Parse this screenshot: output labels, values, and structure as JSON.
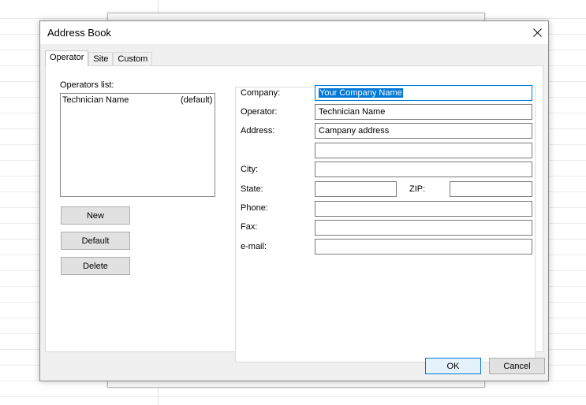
{
  "window": {
    "title": "Address Book"
  },
  "tabs": [
    {
      "label": "Operator",
      "active": true
    },
    {
      "label": "Site",
      "active": false
    },
    {
      "label": "Custom",
      "active": false
    }
  ],
  "operators": {
    "list_label": "Operators list:",
    "items": [
      {
        "name": "Technician Name",
        "tag": "(default)"
      }
    ],
    "buttons": {
      "new": "New",
      "default": "Default",
      "delete": "Delete"
    }
  },
  "form": {
    "company": {
      "label": "Company:",
      "value": "Your Company Name"
    },
    "operator": {
      "label": "Operator:",
      "value": "Technician Name"
    },
    "address": {
      "label": "Address:",
      "value": "Campany address",
      "line2": ""
    },
    "city": {
      "label": "City:",
      "value": ""
    },
    "state": {
      "label": "State:",
      "value": ""
    },
    "zip": {
      "label": "ZIP:",
      "value": ""
    },
    "phone": {
      "label": "Phone:",
      "value": ""
    },
    "fax": {
      "label": "Fax:",
      "value": ""
    },
    "email": {
      "label": "e-mail:",
      "value": ""
    }
  },
  "footer": {
    "ok": "OK",
    "cancel": "Cancel"
  },
  "colors": {
    "accent": "#0078d7",
    "dialog_bg": "#f0f0f0",
    "button_bg": "#e1e1e1"
  },
  "icons": {
    "close": "close-icon"
  }
}
